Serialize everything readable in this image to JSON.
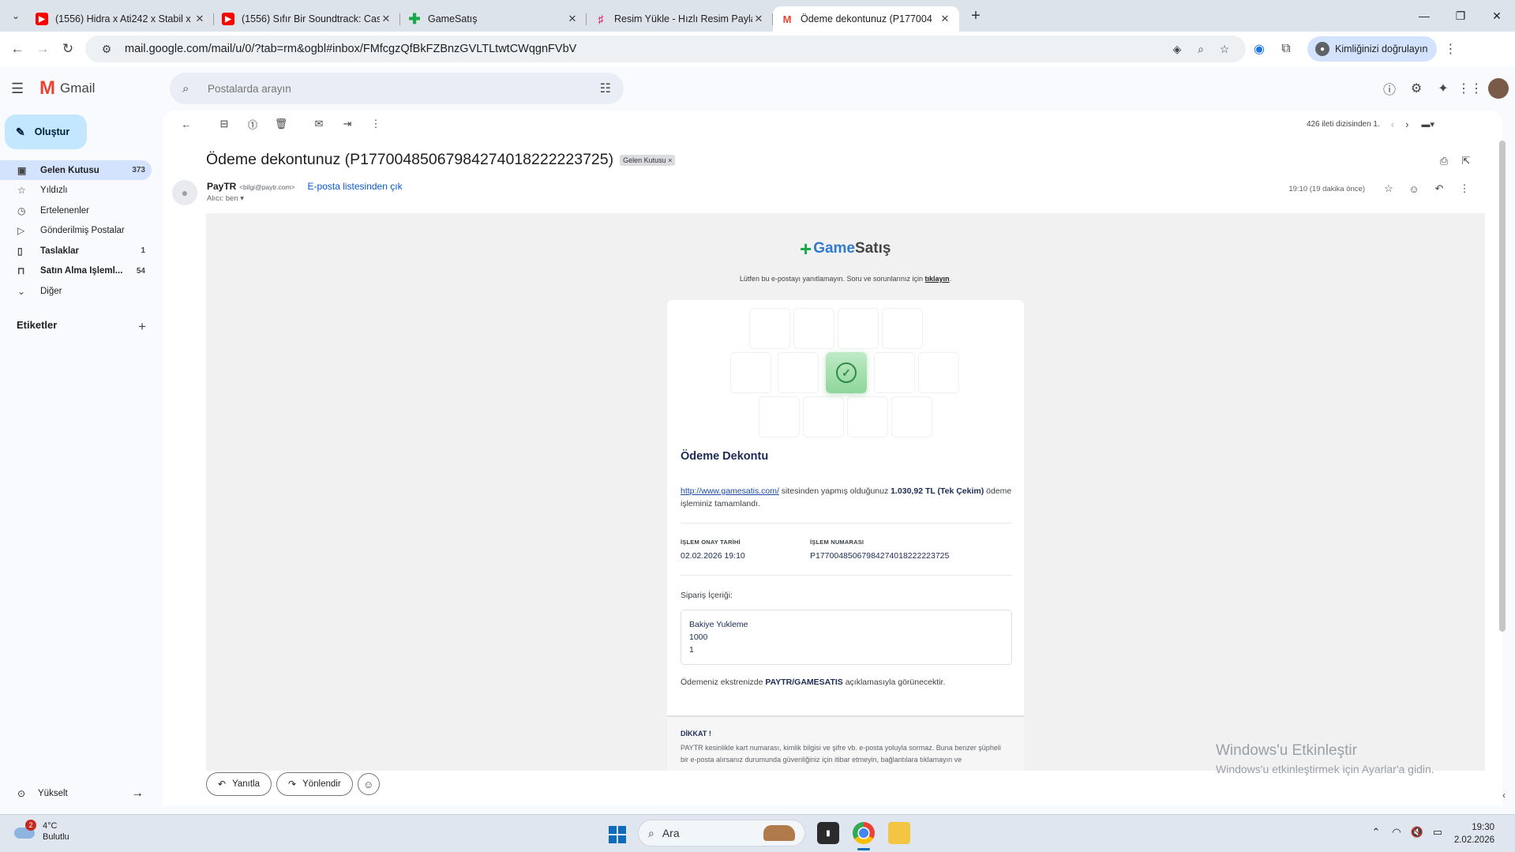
{
  "browser": {
    "tabs": [
      {
        "title": "(1556) Hidra x Ati242 x Stabil x",
        "favicon": "youtube-icon",
        "active": false
      },
      {
        "title": "(1556) Sıfır Bir Soundtrack: Cas",
        "favicon": "youtube-icon",
        "active": false
      },
      {
        "title": "GameSatış",
        "favicon": "gamesatis-icon",
        "active": false
      },
      {
        "title": "Resim Yükle - Hızlı Resim Payla",
        "favicon": "resim-icon",
        "active": false
      },
      {
        "title": "Ödeme dekontunuz (P177004",
        "favicon": "gmail-icon",
        "active": true
      }
    ],
    "url": "mail.google.com/mail/u/0/?tab=rm&ogbl#inbox/FMfcgzQfBkFZBnzGVLTLtwtCWqgnFVbV",
    "verify_label": "Kimliğinizi doğrulayın"
  },
  "gmail": {
    "brand": "Gmail",
    "search_placeholder": "Postalarda arayın",
    "compose_label": "Oluştur",
    "nav": [
      {
        "label": "Gelen Kutusu",
        "count": "373",
        "icon": "inbox-icon",
        "active": true
      },
      {
        "label": "Yıldızlı",
        "count": "",
        "icon": "star-icon",
        "active": false
      },
      {
        "label": "Ertelenenler",
        "count": "",
        "icon": "clock-icon",
        "active": false
      },
      {
        "label": "Gönderilmiş Postalar",
        "count": "",
        "icon": "send-icon",
        "active": false
      },
      {
        "label": "Taslaklar",
        "count": "1",
        "icon": "draft-icon",
        "active": false
      },
      {
        "label": "Satın Alma İşleml...",
        "count": "54",
        "icon": "bag-icon",
        "active": false
      },
      {
        "label": "Diğer",
        "count": "",
        "icon": "chevron-down-icon",
        "active": false
      }
    ],
    "labels_heading": "Etiketler",
    "upgrade_label": "Yükselt",
    "pager_text": "426 ileti dizisinden 1.",
    "reply_label": "Yanıtla",
    "forward_label": "Yönlendir"
  },
  "message": {
    "subject": "Ödeme dekontunuz (P17700485067984274018222223725)",
    "inbox_chip": "Gelen Kutusu ×",
    "sender_name": "PayTR",
    "sender_email": "<bilgi@paytr.com>",
    "recipient": "Alıcı: ben ▾",
    "unsubscribe": "E-posta listesinden çık",
    "time": "19:10 (19 dakika önce)"
  },
  "email_body": {
    "brand_plus": "+",
    "brand_game": "Game",
    "brand_satis": " Satış",
    "noreply_text": "Lütfen bu e-postayı yanıtlamayın. Soru ve sorunlarınız için ",
    "noreply_link": "tıklayın",
    "noreply_end": ".",
    "heading": "Ödeme Dekontu",
    "site_link": "http://www.gamesatis.com/",
    "desc_mid": " sitesinden yapmış olduğunuz ",
    "amount": "1.030,92 TL (Tek Çekim)",
    "desc_end": " ödeme işleminiz tamamlandı.",
    "approval_label": "İŞLEM ONAY TARİHİ",
    "approval_value": "02.02.2026 19:10",
    "txn_label": "İŞLEM NUMARASI",
    "txn_value": "P17700485067984274018222223725",
    "order_label": "Sipariş İçeriği:",
    "order_lines": [
      "Bakiye Yukleme",
      "1000",
      "1"
    ],
    "statement_pre": "Ödemeniz ekstrenizde ",
    "statement_bold": "PAYTR/GAMESATIS",
    "statement_post": " açıklamasıyla görünecektir.",
    "warning_title": "DİKKAT !",
    "warning_text": "PAYTR kesinlikle kart numarası, kimlik bilgisi ve şifre vb. e-posta yoluyla sormaz. Buna benzer şüpheli bir e-posta alırsanız durumunda güvenliğiniz için itibar etmeyin, bağlantılara tıklamayın ve"
  },
  "watermark": {
    "line1": "Windows'u Etkinleştir",
    "line2": "Windows'u etkinleştirmek için Ayarlar'a gidin."
  },
  "taskbar": {
    "weather_temp": "4°C",
    "weather_desc": "Bulutlu",
    "weather_badge": "2",
    "search_label": "Ara",
    "time": "19:30",
    "date": "2.02.2026"
  },
  "colors": {
    "accent": "#0b57d0",
    "compose_bg": "#c2e7ff",
    "active_nav": "#d3e3fd",
    "success": "#2e8b46"
  }
}
